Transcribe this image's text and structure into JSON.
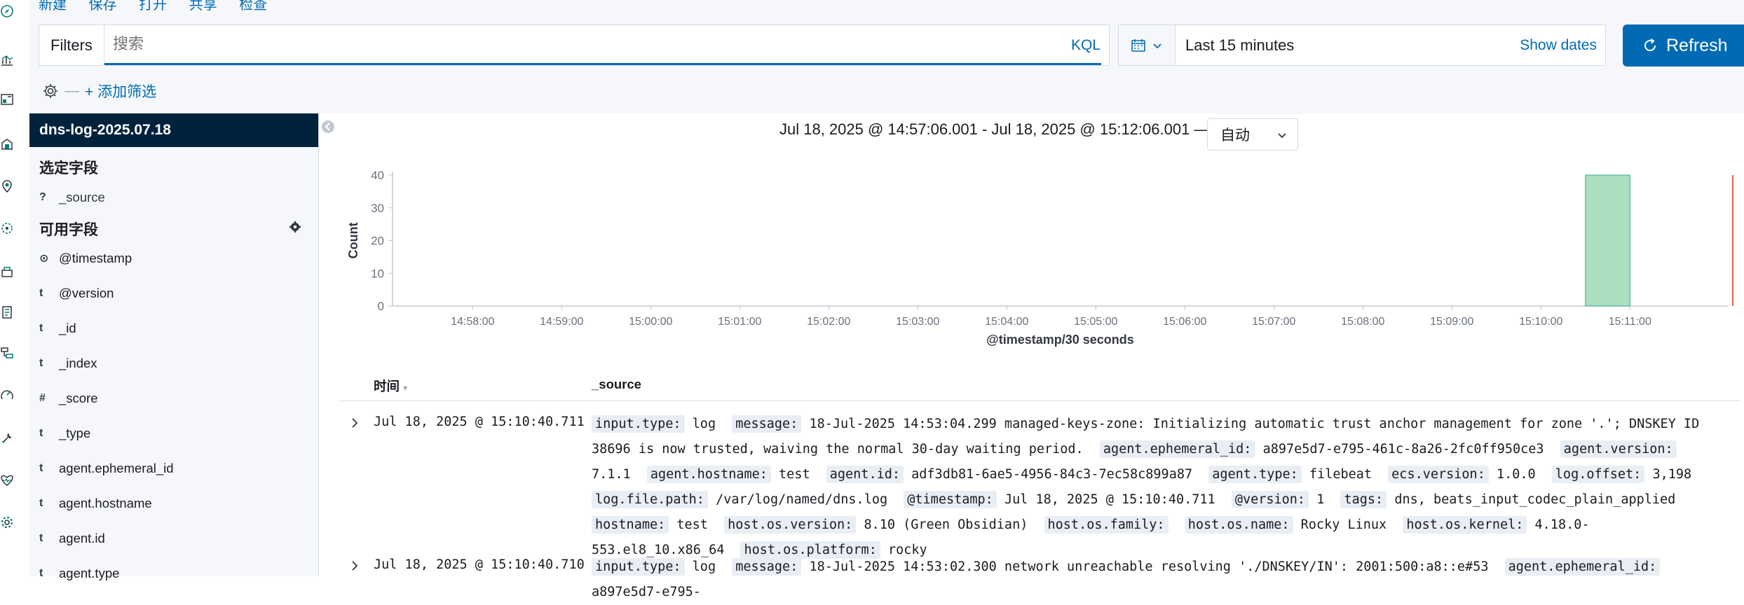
{
  "top_menu": [
    "新建",
    "保存",
    "打开",
    "共享",
    "检查"
  ],
  "query_bar": {
    "filters_label": "Filters",
    "search_placeholder": "搜索",
    "language": "KQL"
  },
  "date_picker": {
    "range": "Last 15 minutes",
    "show_dates": "Show dates"
  },
  "refresh_label": "Refresh",
  "add_filter_label": "+ 添加筛选",
  "sidebar": {
    "index_pattern": "dns-log-2025.07.18",
    "selected_fields_title": "选定字段",
    "selected_fields": [
      {
        "type": "?",
        "name": "_source"
      }
    ],
    "available_fields_title": "可用字段",
    "available_fields": [
      {
        "type": "⊙",
        "name": "@timestamp"
      },
      {
        "type": "t",
        "name": "@version"
      },
      {
        "type": "t",
        "name": "_id"
      },
      {
        "type": "t",
        "name": "_index"
      },
      {
        "type": "#",
        "name": "_score"
      },
      {
        "type": "t",
        "name": "_type"
      },
      {
        "type": "t",
        "name": "agent.ephemeral_id"
      },
      {
        "type": "t",
        "name": "agent.hostname"
      },
      {
        "type": "t",
        "name": "agent.id"
      },
      {
        "type": "t",
        "name": "agent.type"
      }
    ]
  },
  "histogram": {
    "time_span": "Jul 18, 2025 @ 14:57:06.001 - Jul 18, 2025 @ 15:12:06.001 —",
    "interval": "自动"
  },
  "chart_data": {
    "type": "bar",
    "ylabel": "Count",
    "xlabel": "@timestamp/30 seconds",
    "ylim": [
      0,
      40
    ],
    "yticks": [
      0,
      10,
      20,
      30,
      40
    ],
    "xticks": [
      "14:58:00",
      "14:59:00",
      "15:00:00",
      "15:01:00",
      "15:02:00",
      "15:03:00",
      "15:04:00",
      "15:05:00",
      "15:06:00",
      "15:07:00",
      "15:08:00",
      "15:09:00",
      "15:10:00",
      "15:11:00"
    ],
    "bars": [
      {
        "start": "15:10:30",
        "value": 40
      }
    ],
    "bar_color": "#a9dfbf",
    "bar_edge_color": "#54b399",
    "now_line_color": "#e7664c"
  },
  "table": {
    "col_time": "时间",
    "col_source": "_source",
    "rows": [
      {
        "time": "Jul 18, 2025 @ 15:10:40.711",
        "fields": [
          {
            "k": "input.type:",
            "v": "log"
          },
          {
            "k": "message:",
            "v": "18-Jul-2025 14:53:04.299 managed-keys-zone: Initializing automatic trust anchor management for zone '.'; DNSKEY ID 38696 is now trusted, waiving the normal 30-day waiting period."
          },
          {
            "k": "agent.ephemeral_id:",
            "v": "a897e5d7-e795-461c-8a26-2fc0ff950ce3"
          },
          {
            "k": "agent.version:",
            "v": "7.1.1"
          },
          {
            "k": "agent.hostname:",
            "v": "test"
          },
          {
            "k": "agent.id:",
            "v": "adf3db81-6ae5-4956-84c3-7ec58c899a87"
          },
          {
            "k": "agent.type:",
            "v": "filebeat"
          },
          {
            "k": "ecs.version:",
            "v": "1.0.0"
          },
          {
            "k": "log.offset:",
            "v": "3,198"
          },
          {
            "k": "log.file.path:",
            "v": "/var/log/named/dns.log"
          },
          {
            "k": "@timestamp:",
            "v": "Jul 18, 2025 @ 15:10:40.711"
          },
          {
            "k": "@version:",
            "v": "1"
          },
          {
            "k": "tags:",
            "v": "dns, beats_input_codec_plain_applied"
          },
          {
            "k": "hostname:",
            "v": "test"
          },
          {
            "k": "host.os.version:",
            "v": "8.10 (Green Obsidian)"
          },
          {
            "k": "host.os.family:",
            "v": ""
          },
          {
            "k": "host.os.name:",
            "v": "Rocky Linux"
          },
          {
            "k": "host.os.kernel:",
            "v": "4.18.0-553.el8_10.x86_64"
          },
          {
            "k": "host.os.platform:",
            "v": "rocky"
          }
        ]
      },
      {
        "time": "Jul 18, 2025 @ 15:10:40.710",
        "fields": [
          {
            "k": "input.type:",
            "v": "log"
          },
          {
            "k": "message:",
            "v": "18-Jul-2025 14:53:02.300 network unreachable resolving './DNSKEY/IN': 2001:500:a8::e#53"
          },
          {
            "k": "agent.ephemeral_id:",
            "v": "a897e5d7-e795-"
          }
        ]
      }
    ]
  }
}
